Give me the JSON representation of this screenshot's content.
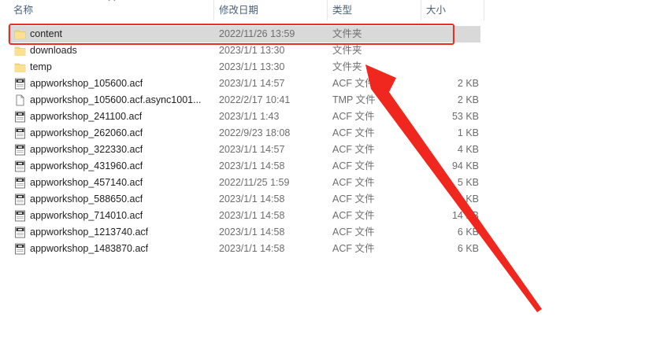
{
  "columns": {
    "name": "名称",
    "date": "修改日期",
    "type": "类型",
    "size": "大小"
  },
  "files": [
    {
      "name": "content",
      "date": "2022/11/26 13:59",
      "type": "文件夹",
      "size": "",
      "icon": "folder-icon",
      "selected": true
    },
    {
      "name": "downloads",
      "date": "2023/1/1 13:30",
      "type": "文件夹",
      "size": "",
      "icon": "folder-icon"
    },
    {
      "name": "temp",
      "date": "2023/1/1 13:30",
      "type": "文件夹",
      "size": "",
      "icon": "folder-icon"
    },
    {
      "name": "appworkshop_105600.acf",
      "date": "2023/1/1 14:57",
      "type": "ACF 文件",
      "size": "2 KB",
      "icon": "acf-file-icon"
    },
    {
      "name": "appworkshop_105600.acf.async1001...",
      "date": "2022/2/17 10:41",
      "type": "TMP 文件",
      "size": "2 KB",
      "icon": "blank-file-icon"
    },
    {
      "name": "appworkshop_241100.acf",
      "date": "2023/1/1 1:43",
      "type": "ACF 文件",
      "size": "53 KB",
      "icon": "acf-file-icon"
    },
    {
      "name": "appworkshop_262060.acf",
      "date": "2022/9/23 18:08",
      "type": "ACF 文件",
      "size": "1 KB",
      "icon": "acf-file-icon"
    },
    {
      "name": "appworkshop_322330.acf",
      "date": "2023/1/1 14:57",
      "type": "ACF 文件",
      "size": "4 KB",
      "icon": "acf-file-icon"
    },
    {
      "name": "appworkshop_431960.acf",
      "date": "2023/1/1 14:58",
      "type": "ACF 文件",
      "size": "94 KB",
      "icon": "acf-file-icon"
    },
    {
      "name": "appworkshop_457140.acf",
      "date": "2022/11/25 1:59",
      "type": "ACF 文件",
      "size": "5 KB",
      "icon": "acf-file-icon"
    },
    {
      "name": "appworkshop_588650.acf",
      "date": "2023/1/1 14:58",
      "type": "ACF 文件",
      "size": "2 KB",
      "icon": "acf-file-icon"
    },
    {
      "name": "appworkshop_714010.acf",
      "date": "2023/1/1 14:58",
      "type": "ACF 文件",
      "size": "14 KB",
      "icon": "acf-file-icon"
    },
    {
      "name": "appworkshop_1213740.acf",
      "date": "2023/1/1 14:58",
      "type": "ACF 文件",
      "size": "6 KB",
      "icon": "acf-file-icon"
    },
    {
      "name": "appworkshop_1483870.acf",
      "date": "2023/1/1 14:58",
      "type": "ACF 文件",
      "size": "6 KB",
      "icon": "acf-file-icon"
    }
  ],
  "colors": {
    "highlight_border": "#ee2a24",
    "arrow": "#f0271f",
    "selected_row": "#d9d9d9",
    "folder": "#f8d775"
  }
}
